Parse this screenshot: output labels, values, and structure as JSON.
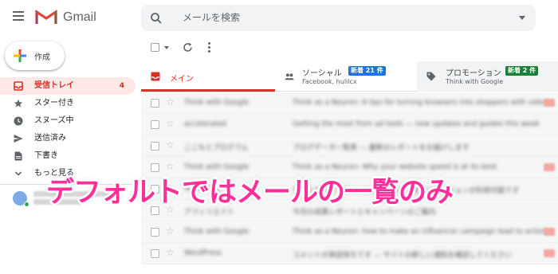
{
  "app": {
    "name": "Gmail"
  },
  "search": {
    "placeholder": "メールを検索"
  },
  "compose": {
    "label": "作成"
  },
  "sidebar": {
    "items": [
      {
        "label": "受信トレイ",
        "count": "4",
        "icon": "inbox-icon",
        "active": true
      },
      {
        "label": "スター付き",
        "count": "",
        "icon": "star-icon"
      },
      {
        "label": "スヌーズ中",
        "count": "",
        "icon": "clock-icon"
      },
      {
        "label": "送信済み",
        "count": "",
        "icon": "send-icon"
      },
      {
        "label": "下書き",
        "count": "",
        "icon": "draft-icon"
      },
      {
        "label": "もっと見る",
        "count": "",
        "icon": "chevron-down-icon"
      }
    ]
  },
  "tabs": [
    {
      "label": "メイン",
      "icon": "inbox-icon",
      "active": true
    },
    {
      "label": "ソーシャル",
      "icon": "people-icon",
      "badge": "新着 21 件",
      "sub": "Facebook, hulilcx",
      "badge_color": "#1a73e8"
    },
    {
      "label": "プロモーション",
      "icon": "tag-icon",
      "badge": "新着 2 件",
      "sub": "Think with Google",
      "badge_color": "#188038"
    }
  ],
  "mail_rows": [
    {
      "sender": "Think with Google",
      "subject": "Think as a Neuron: 6 tips for turning browsers into shoppers with video",
      "tag": true
    },
    {
      "sender": "accelerated",
      "subject": "Getting the most from ad tools — new updates and guides this week",
      "tag": false
    },
    {
      "sender": "ここもとプログラム",
      "subject": "ブログデータ一覧表 — 最新のレポートをお届けします",
      "tag": false
    },
    {
      "sender": "Think with Google",
      "subject": "Think as a Neuron: Why your website speed is at its best",
      "tag": true
    },
    {
      "sender": "WordPress",
      "subject": "サイトのアップデートのお知らせ — 新しいバージョンが利用可能です",
      "tag": false
    },
    {
      "sender": "アフィリエイト",
      "subject": "今月の成果レポートとキャンペーンのご案内",
      "tag": false
    },
    {
      "sender": "Think with Google",
      "subject": "Think as a Neuron: how to make an influencer campaign lead to action",
      "tag": true
    },
    {
      "sender": "WordPress",
      "subject": "コメントが承認待ちです — サイトの新しい通知を確認してください",
      "tag": true
    }
  ],
  "caption": "デフォルトではメールの一覧のみ",
  "colors": {
    "accent_red": "#d93025",
    "caption_pink": "#ff2f9a",
    "badge_blue": "#1a73e8",
    "badge_green": "#188038"
  }
}
